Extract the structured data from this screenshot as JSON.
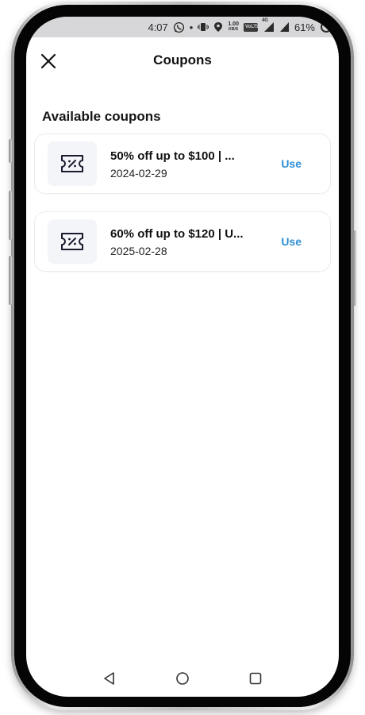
{
  "status_bar": {
    "time": "4:07",
    "dot": "•",
    "net_speed_value": "1.00",
    "net_speed_unit": "KB/S",
    "volte_label": "VoLTE",
    "signal_4g": "4G",
    "battery": "61%",
    "icons": [
      "whatsapp-icon",
      "vibrate-icon",
      "location-icon",
      "volte-icon",
      "signal-icon",
      "signal-icon",
      "battery-icon"
    ]
  },
  "header": {
    "close_icon": "close-icon",
    "title": "Coupons"
  },
  "main": {
    "section_title": "Available coupons",
    "coupons": [
      {
        "title": "50% off up to $100 | ...",
        "date": "2024-02-29",
        "action_label": "Use",
        "icon": "coupon-ticket-icon"
      },
      {
        "title": "60% off up to $120 | U...",
        "date": "2025-02-28",
        "action_label": "Use",
        "icon": "coupon-ticket-icon"
      }
    ]
  },
  "nav_bar": {
    "icons": [
      "back-triangle-icon",
      "home-circle-icon",
      "recents-square-icon"
    ]
  },
  "colors": {
    "accent": "#2f8fd6",
    "status_bar_bg": "#d7d7d9",
    "card_border": "#ececf0",
    "thumb_bg": "#f4f5f8",
    "text_primary": "#111111"
  }
}
